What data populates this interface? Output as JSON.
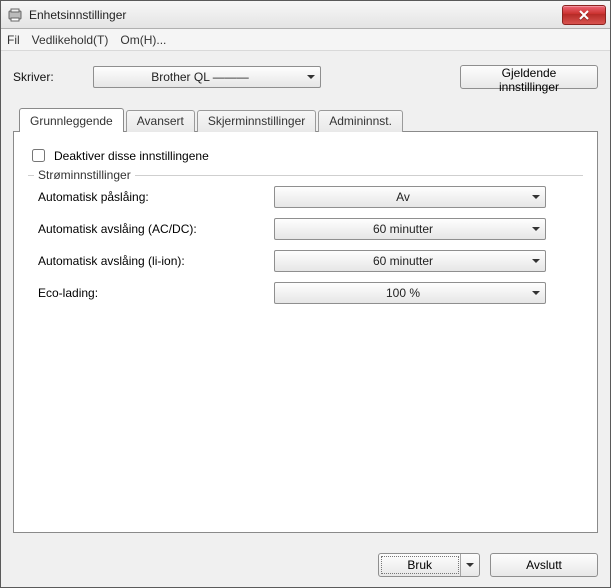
{
  "window": {
    "title": "Enhetsinnstillinger"
  },
  "menu": {
    "file": "Fil",
    "maintain": "Vedlikehold(T)",
    "about": "Om(H)..."
  },
  "printer": {
    "label": "Skriver:",
    "value": "Brother QL ———",
    "current_button": "Gjeldende innstillinger"
  },
  "tabs": {
    "basic": "Grunnleggende",
    "advanced": "Avansert",
    "display": "Skjerminnstillinger",
    "admin": "Admininnst."
  },
  "basic": {
    "disable_label": "Deaktiver disse innstillingene",
    "group_title": "Strøminnstillinger",
    "rows": {
      "auto_on": {
        "label": "Automatisk påslåing:",
        "value": "Av"
      },
      "auto_off_ac": {
        "label": "Automatisk avslåing (AC/DC):",
        "value": "60 minutter"
      },
      "auto_off_li": {
        "label": "Automatisk avslåing (li-ion):",
        "value": "60 minutter"
      },
      "eco": {
        "label": "Eco-lading:",
        "value": "100 %"
      }
    }
  },
  "footer": {
    "apply": "Bruk",
    "close": "Avslutt"
  }
}
